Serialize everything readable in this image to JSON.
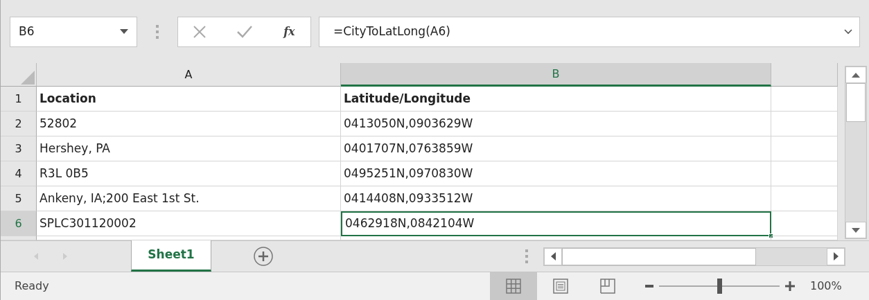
{
  "name_box": {
    "value": "B6"
  },
  "formula_bar": {
    "function_label": "fx",
    "formula": "=CityToLatLong(A6)"
  },
  "columns": [
    {
      "label": "A",
      "selected": false
    },
    {
      "label": "B",
      "selected": true
    }
  ],
  "rows": [
    {
      "number": "1",
      "selected": false,
      "bold": true,
      "cells": [
        {
          "text": "Location",
          "selected": false
        },
        {
          "text": "Latitude/Longitude",
          "selected": false
        }
      ]
    },
    {
      "number": "2",
      "selected": false,
      "bold": false,
      "cells": [
        {
          "text": "52802",
          "selected": false
        },
        {
          "text": "0413050N,0903629W",
          "selected": false
        }
      ]
    },
    {
      "number": "3",
      "selected": false,
      "bold": false,
      "cells": [
        {
          "text": "Hershey, PA",
          "selected": false
        },
        {
          "text": "0401707N,0763859W",
          "selected": false
        }
      ]
    },
    {
      "number": "4",
      "selected": false,
      "bold": false,
      "cells": [
        {
          "text": "R3L 0B5",
          "selected": false
        },
        {
          "text": "0495251N,0970830W",
          "selected": false
        }
      ]
    },
    {
      "number": "5",
      "selected": false,
      "bold": false,
      "cells": [
        {
          "text": "Ankeny, IA;200 East 1st St.",
          "selected": false
        },
        {
          "text": "0414408N,0933512W",
          "selected": false
        }
      ]
    },
    {
      "number": "6",
      "selected": true,
      "bold": false,
      "cells": [
        {
          "text": "SPLC301120002",
          "selected": false
        },
        {
          "text": "0462918N,0842104W",
          "selected": true
        }
      ]
    }
  ],
  "sheet_tabs": [
    {
      "label": "Sheet1",
      "selected": true
    }
  ],
  "status_bar": {
    "status": "Ready",
    "views": [
      {
        "kind": "normal",
        "selected": true
      },
      {
        "kind": "page_layout",
        "selected": false
      },
      {
        "kind": "page_break",
        "selected": false
      }
    ],
    "zoom": {
      "level": 0.5,
      "reading": "100%"
    }
  }
}
